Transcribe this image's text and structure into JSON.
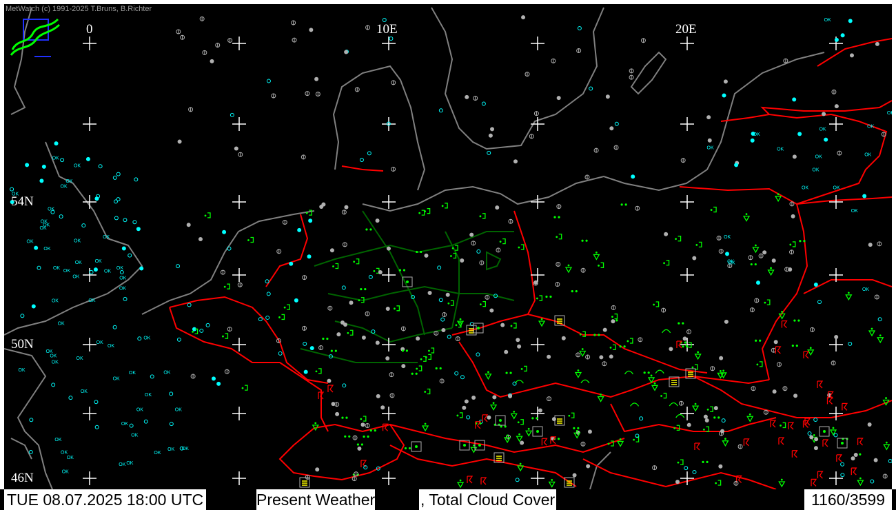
{
  "app": {
    "credit": "MetWatch  (c) 1991-2025 T.Bruns, B.Richter"
  },
  "map": {
    "lon_labels": [
      "0",
      "10E",
      "20E"
    ],
    "lat_labels": [
      "54N",
      "50N",
      "46N"
    ],
    "colors": {
      "background": "#000000",
      "coast": "#808080",
      "border": "#ff0000",
      "state_border": "#006400",
      "grid": "#ffffff",
      "no_weather": "#00ffff",
      "rain": "#00ff00",
      "thunder": "#ff0000",
      "fog": "#ffff00",
      "cloud_dot": "#b0b0b0"
    },
    "station_code": "OK"
  },
  "status": {
    "datetime": "TUE 08.07.2025 18:00 UTC",
    "product": "Present Weather",
    "product2": ", Total Cloud Cover",
    "count": "1160/3599"
  }
}
